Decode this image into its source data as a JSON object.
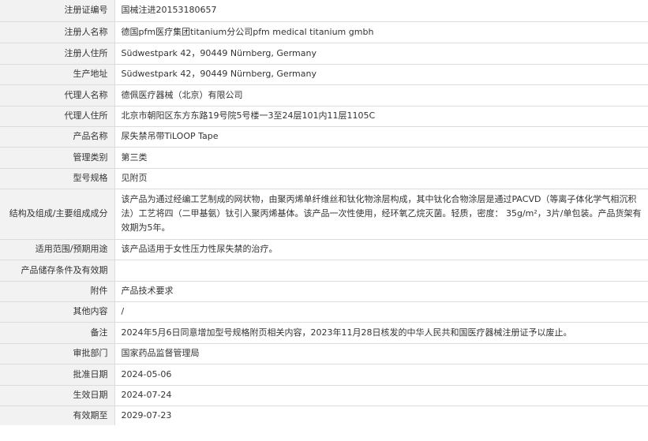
{
  "rows": [
    {
      "label": "注册证编号",
      "value": "国械注进20153180657"
    },
    {
      "label": "注册人名称",
      "value": "德国pfm医疗集团titanium分公司pfm medical titanium gmbh"
    },
    {
      "label": "注册人住所",
      "value": "Südwestpark 42，90449 Nürnberg, Germany"
    },
    {
      "label": "生产地址",
      "value": "Südwestpark 42，90449 Nürnberg, Germany"
    },
    {
      "label": "代理人名称",
      "value": "德佩医疗器械（北京）有限公司"
    },
    {
      "label": "代理人住所",
      "value": "北京市朝阳区东方东路19号院5号楼一3至24层101内11层1105C"
    },
    {
      "label": "产品名称",
      "value": "尿失禁吊带TiLOOP Tape"
    },
    {
      "label": "管理类别",
      "value": "第三类"
    },
    {
      "label": "型号规格",
      "value": "见附页"
    },
    {
      "label": "结构及组成/主要组成成分",
      "value": "该产品为通过经编工艺制成的网状物，由聚丙烯单纤维丝和钛化物涂层构成，其中钛化合物涂层是通过PACVD（等离子体化学气相沉积法）工艺将四（二甲基氨）钛引入聚丙烯基体。该产品一次性使用，经环氧乙烷灭菌。轻质，密度： 35g/m²，3片/单包装。产品货架有效期为5年。"
    },
    {
      "label": "适用范围/预期用途",
      "value": "该产品适用于女性压力性尿失禁的治疗。"
    },
    {
      "label": "产品储存条件及有效期",
      "value": ""
    },
    {
      "label": "附件",
      "value": "产品技术要求"
    },
    {
      "label": "其他内容",
      "value": "/"
    },
    {
      "label": "备注",
      "value": "2024年5月6日同意增加型号规格附页相关内容，2023年11月28日核发的中华人民共和国医疗器械注册证予以废止。"
    },
    {
      "label": "审批部门",
      "value": "国家药品监督管理局"
    },
    {
      "label": "批准日期",
      "value": "2024-05-06"
    },
    {
      "label": "生效日期",
      "value": "2024-07-24"
    },
    {
      "label": "有效期至",
      "value": "2029-07-23"
    }
  ]
}
